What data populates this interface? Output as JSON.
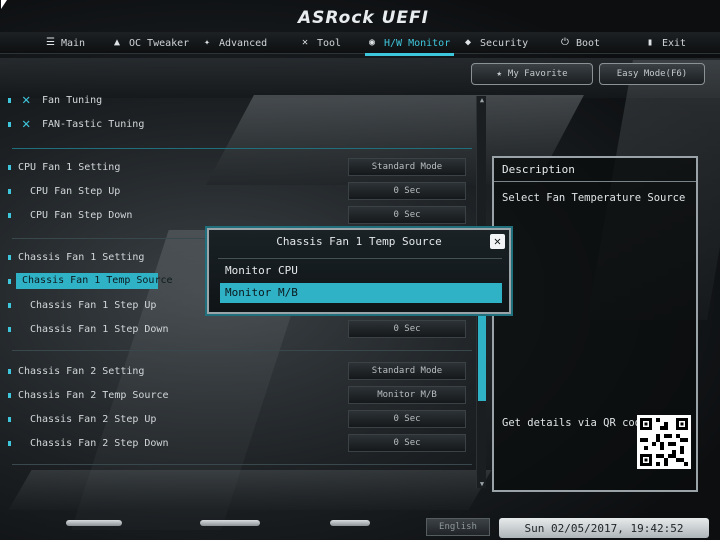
{
  "brand": "ASRock UEFI",
  "nav": {
    "tabs": [
      {
        "label": "Main",
        "icon": "list-icon"
      },
      {
        "label": "OC Tweaker",
        "icon": "rocket-icon"
      },
      {
        "label": "Advanced",
        "icon": "star-icon"
      },
      {
        "label": "Tool",
        "icon": "tools-icon"
      },
      {
        "label": "H/W Monitor",
        "icon": "monitor-icon",
        "active": true
      },
      {
        "label": "Security",
        "icon": "shield-icon"
      },
      {
        "label": "Boot",
        "icon": "power-icon"
      },
      {
        "label": "Exit",
        "icon": "exit-icon"
      }
    ]
  },
  "buttons": {
    "favorite": "My Favorite",
    "easy_mode": "Easy Mode(F6)"
  },
  "menu": {
    "fan_tuning": "Fan Tuning",
    "fan_tastic": "FAN-Tastic Tuning",
    "cpu_fan1_setting": {
      "label": "CPU Fan 1 Setting",
      "value": "Standard Mode"
    },
    "cpu_fan_step_up": {
      "label": "CPU Fan Step Up",
      "value": "0 Sec"
    },
    "cpu_fan_step_down": {
      "label": "CPU Fan Step Down",
      "value": "0 Sec"
    },
    "chassis_fan1_setting": {
      "label": "Chassis Fan 1 Setting"
    },
    "chassis_fan1_temp_source": {
      "label": "Chassis Fan 1 Temp Source"
    },
    "chassis_fan1_step_up": {
      "label": "Chassis Fan 1 Step Up"
    },
    "chassis_fan1_step_down": {
      "label": "Chassis Fan 1 Step Down",
      "value": "0 Sec"
    },
    "chassis_fan2_setting": {
      "label": "Chassis Fan 2 Setting",
      "value": "Standard Mode"
    },
    "chassis_fan2_temp_source": {
      "label": "Chassis Fan 2 Temp Source",
      "value": "Monitor M/B"
    },
    "chassis_fan2_step_up": {
      "label": "Chassis Fan 2 Step Up",
      "value": "0 Sec"
    },
    "chassis_fan2_step_down": {
      "label": "Chassis Fan 2 Step Down",
      "value": "0 Sec"
    }
  },
  "description": {
    "title": "Description",
    "text": "Select Fan Temperature Source",
    "qr_label": "Get details via QR code"
  },
  "popup": {
    "title": "Chassis Fan 1 Temp Source",
    "options": [
      "Monitor CPU",
      "Monitor M/B"
    ],
    "selected_index": 1
  },
  "footer": {
    "language": "English",
    "datetime": "Sun 02/05/2017, 19:42:52"
  },
  "colors": {
    "accent": "#2fb1c6",
    "background": "#0b0d0e"
  }
}
